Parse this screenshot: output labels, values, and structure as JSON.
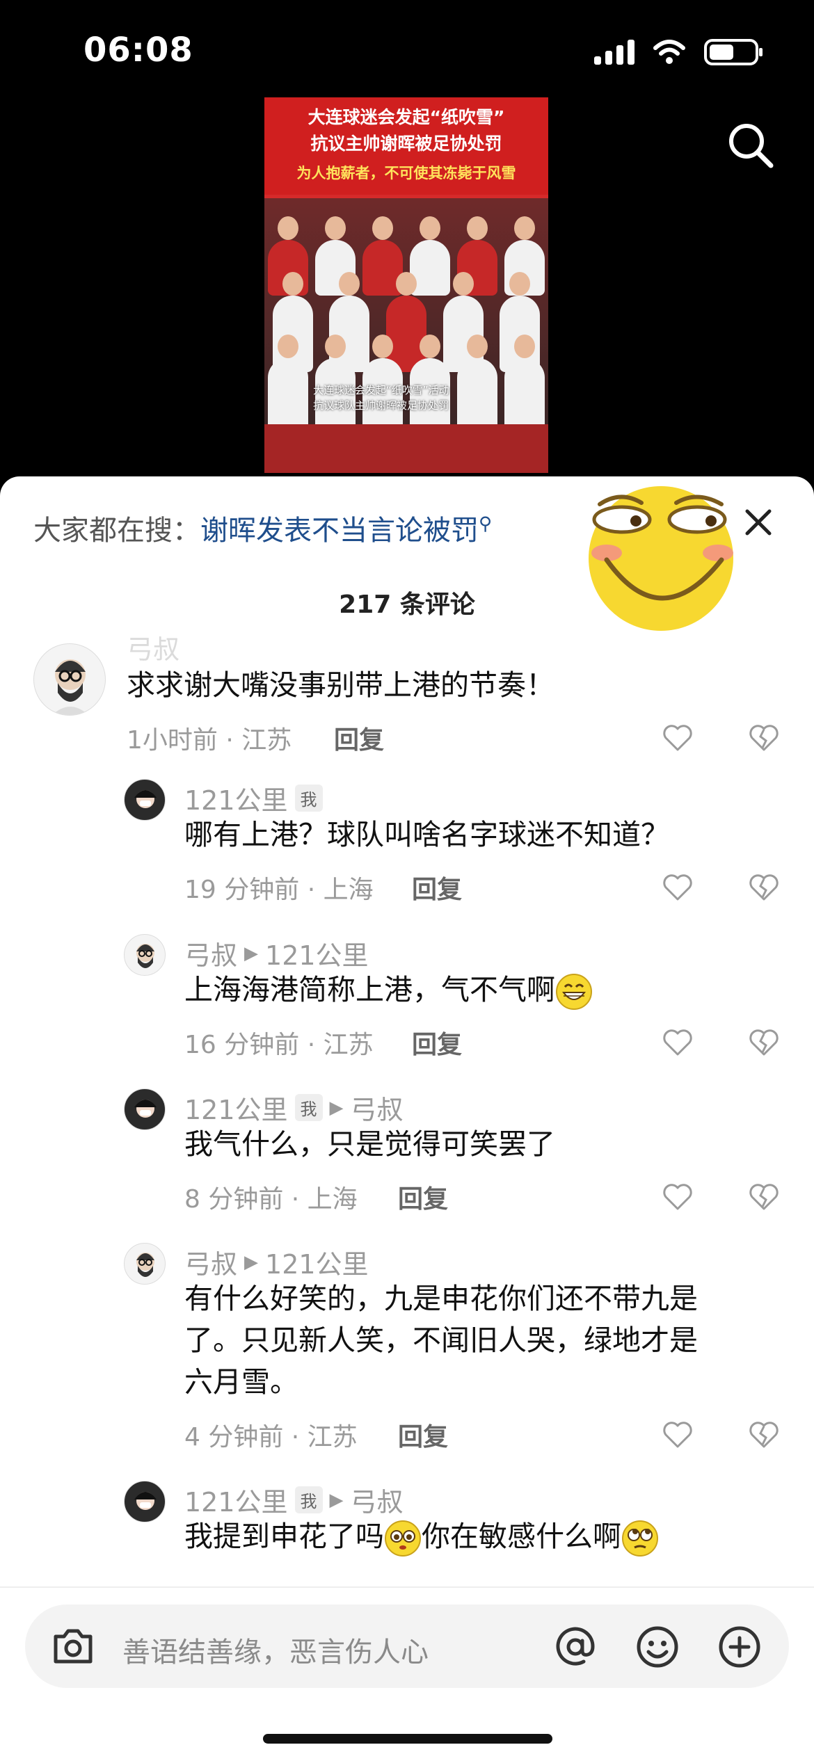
{
  "status": {
    "time": "06:08"
  },
  "video": {
    "line1": "大连球迷会发起“纸吹雪”",
    "line2": "抗议主帅谢晖被足协处罚",
    "line3": "为人抱薪者，不可使其冻毙于风雪",
    "caption1": "大连球迷会发起“纸吹雪”活动",
    "caption2": "抗议球队主帅谢晖被足协处罚"
  },
  "trending": {
    "label": "大家都在搜：",
    "query": "谢晖发表不当言论被罚"
  },
  "comments_count": "217 条评论",
  "comments": [
    {
      "user": "弓叔",
      "text": "求求谢大嘴没事别带上港的节奏！",
      "meta": "1小时前 · 江苏",
      "reply": "回复"
    },
    {
      "user": "121公里",
      "me": "我",
      "text": "哪有上港？球队叫啥名字球迷不知道？",
      "meta": "19 分钟前 · 上海",
      "reply": "回复"
    },
    {
      "user": "弓叔",
      "target": "121公里",
      "text": "上海海港简称上港，气不气啊",
      "meta": "16 分钟前 · 江苏",
      "reply": "回复"
    },
    {
      "user": "121公里",
      "me": "我",
      "target": "弓叔",
      "text": "我气什么，只是觉得可笑罢了",
      "meta": "8 分钟前 · 上海",
      "reply": "回复"
    },
    {
      "user": "弓叔",
      "target": "121公里",
      "text_lines": [
        "有什么好笑的，九是申花你们还不带九是",
        "了。只见新人笑，不闻旧人哭，绿地才是",
        "六月雪。"
      ],
      "meta": "4 分钟前 · 江苏",
      "reply": "回复"
    },
    {
      "user": "121公里",
      "me": "我",
      "target": "弓叔",
      "text_a": "我提到申花了吗",
      "text_b": "你在敏感什么啊"
    }
  ],
  "input": {
    "placeholder": "善语结善缘，恶言伤人心"
  },
  "colors": {
    "link": "#1f4e8c",
    "video_red": "#d01f1f",
    "emoji_yellow": "#f7d830"
  }
}
